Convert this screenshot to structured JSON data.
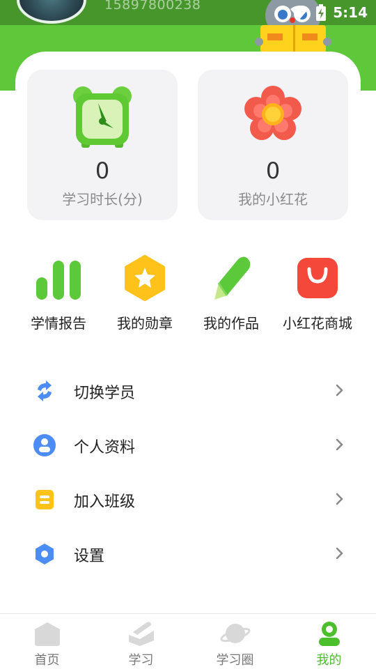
{
  "status_bar": {
    "time": "5:14"
  },
  "profile": {
    "phone": "15897800238"
  },
  "stats": [
    {
      "value": "0",
      "label": "学习时长(分)",
      "icon": "alarm-clock-icon"
    },
    {
      "value": "0",
      "label": "我的小红花",
      "icon": "red-flower-icon"
    }
  ],
  "shortcuts": [
    {
      "label": "学情报告",
      "icon": "bar-chart-icon"
    },
    {
      "label": "我的勋章",
      "icon": "medal-star-icon"
    },
    {
      "label": "我的作品",
      "icon": "pencil-icon"
    },
    {
      "label": "小红花商城",
      "icon": "shopping-bag-icon"
    }
  ],
  "menu": [
    {
      "label": "切换学员",
      "icon": "switch-icon"
    },
    {
      "label": "个人资料",
      "icon": "user-profile-icon"
    },
    {
      "label": "加入班级",
      "icon": "class-icon"
    },
    {
      "label": "设置",
      "icon": "settings-icon"
    }
  ],
  "tabs": [
    {
      "label": "首页",
      "icon": "home-icon"
    },
    {
      "label": "学习",
      "icon": "book-icon"
    },
    {
      "label": "学习圈",
      "icon": "planet-icon"
    },
    {
      "label": "我的",
      "icon": "me-icon"
    }
  ],
  "colors": {
    "brand_green": "#5ec83a",
    "active_tab": "#4cc02c",
    "flower_red": "#f25a4c",
    "bag_red": "#f4483a",
    "medal_yellow": "#ffc21a",
    "menu_blue": "#4c8cf5"
  }
}
